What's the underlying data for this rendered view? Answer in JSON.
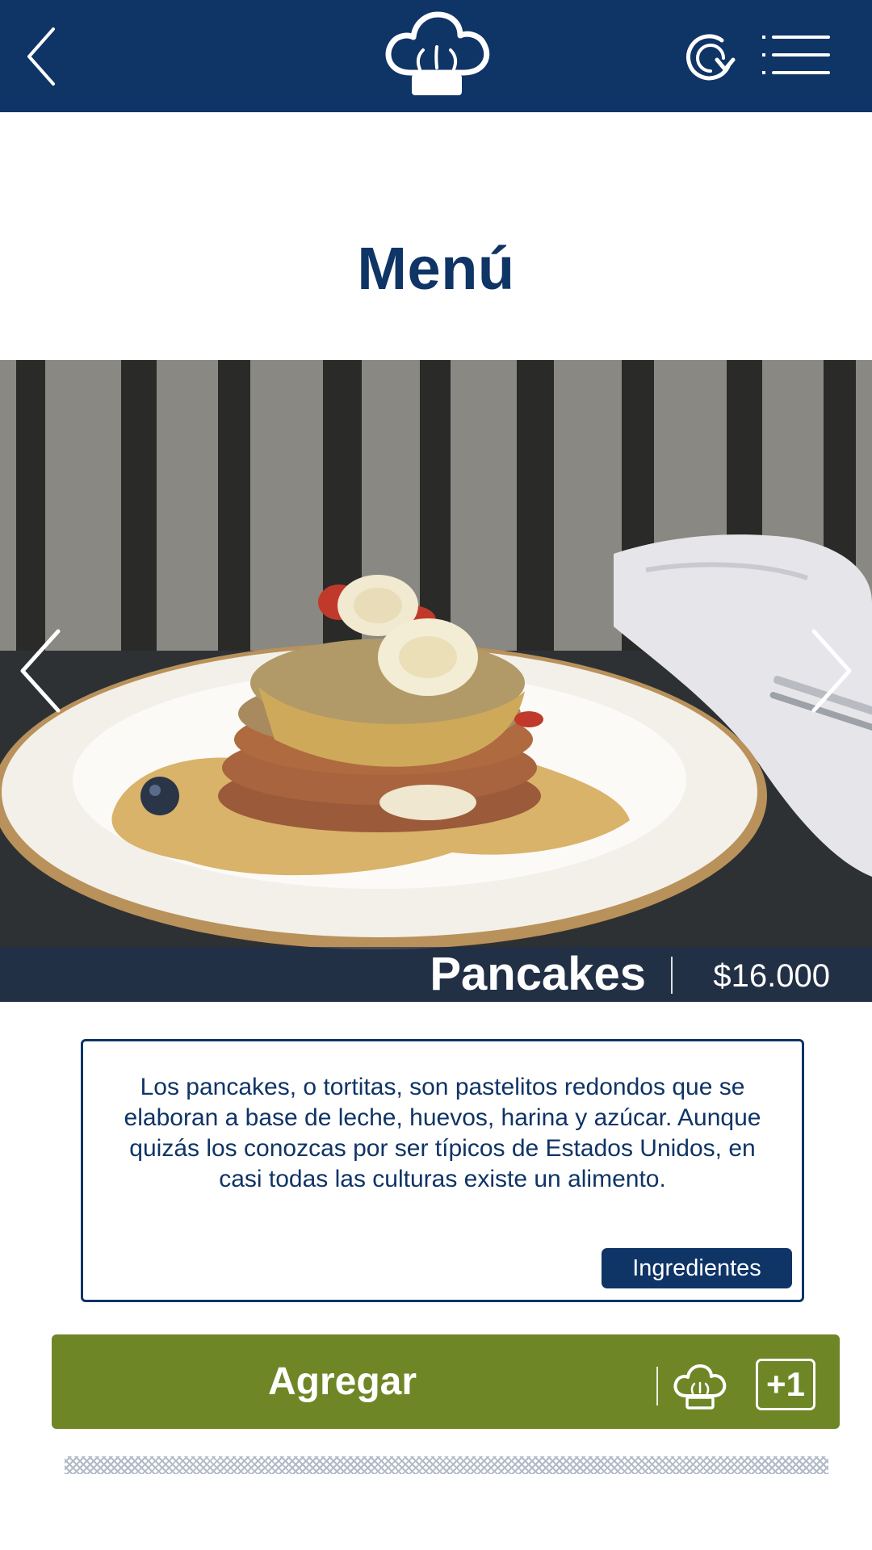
{
  "header": {
    "back_icon": "chevron-left-icon",
    "logo_icon": "chef-hat-icon",
    "refresh_icon": "refresh-icon",
    "menu_icon": "list-menu-icon"
  },
  "page": {
    "title": "Menú"
  },
  "dish": {
    "name": "Pancakes",
    "price": "$16.000",
    "description": "Los pancakes, o tortitas, son pastelitos redondos que se elaboran a base de leche, huevos, harina y azúcar. Aunque quizás los conozcas por ser típicos de Estados Unidos, en casi todas las culturas existe un alimento.",
    "ingredients_label": "Ingredientes"
  },
  "carousel": {
    "prev_icon": "chevron-left-icon",
    "next_icon": "chevron-right-icon"
  },
  "actions": {
    "add_label": "Agregar",
    "add_icon": "chef-hat-icon",
    "plus_one": "+1"
  },
  "colors": {
    "brand_navy": "#0f3466",
    "add_green": "#6f8626",
    "white": "#ffffff"
  }
}
